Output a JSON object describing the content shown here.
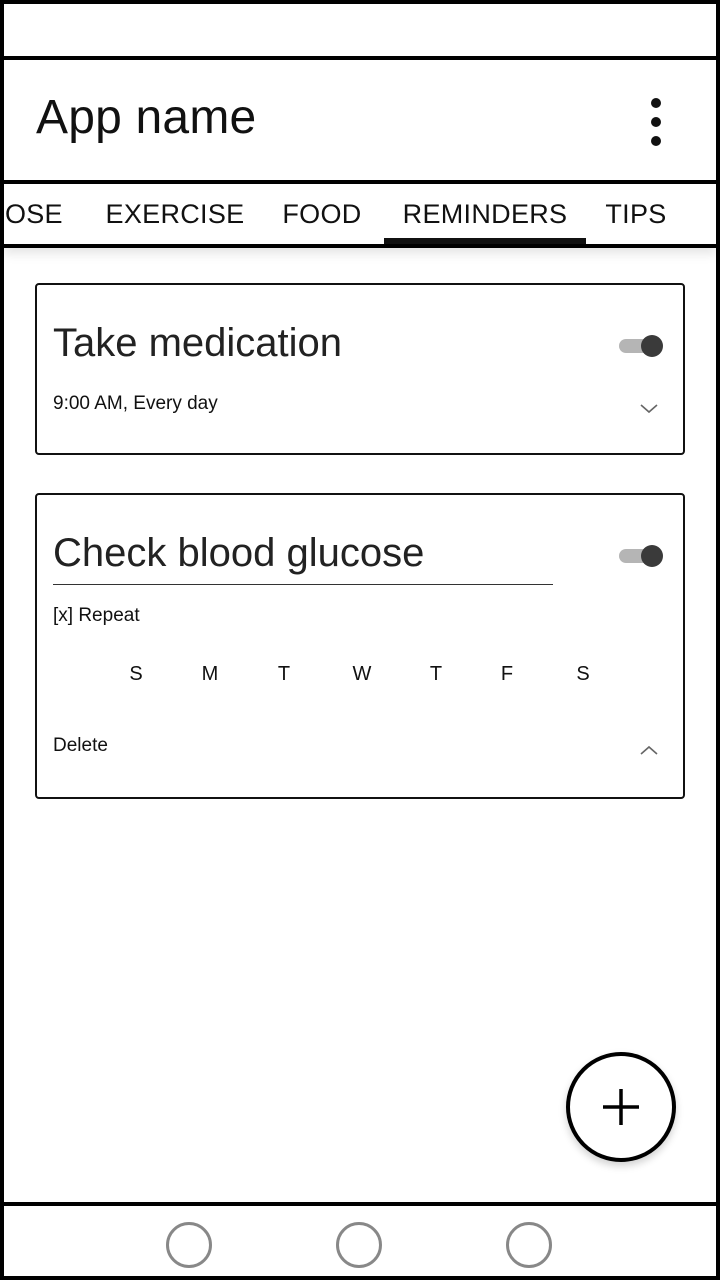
{
  "app_bar": {
    "title": "App name",
    "overflow_icon": "more-vertical-icon"
  },
  "tabs": [
    {
      "label": "COSE",
      "selected": false
    },
    {
      "label": "EXERCISE",
      "selected": false
    },
    {
      "label": "FOOD",
      "selected": false
    },
    {
      "label": "REMINDERS",
      "selected": true
    },
    {
      "label": "TIPS",
      "selected": false
    }
  ],
  "reminders": [
    {
      "title": "Take medication",
      "enabled": true,
      "schedule": "9:00 AM, Every day",
      "expanded": false,
      "chevron_icon": "chevron-down-icon"
    },
    {
      "title": "Check blood glucose",
      "enabled": true,
      "expanded": true,
      "repeat_label": "[x] Repeat",
      "weekdays": [
        "S",
        "M",
        "T",
        "W",
        "T",
        "F",
        "S"
      ],
      "delete_label": "Delete",
      "chevron_icon": "chevron-up-icon"
    }
  ],
  "fab": {
    "icon": "plus-icon"
  },
  "nav_bar": {
    "buttons": [
      "nav-button-left",
      "nav-button-center",
      "nav-button-right"
    ]
  },
  "colors": {
    "border": "#000000",
    "text": "#111111",
    "toggle_track": "#b5b5b5",
    "toggle_thumb": "#3a3a3a",
    "nav_button": "#888888"
  }
}
